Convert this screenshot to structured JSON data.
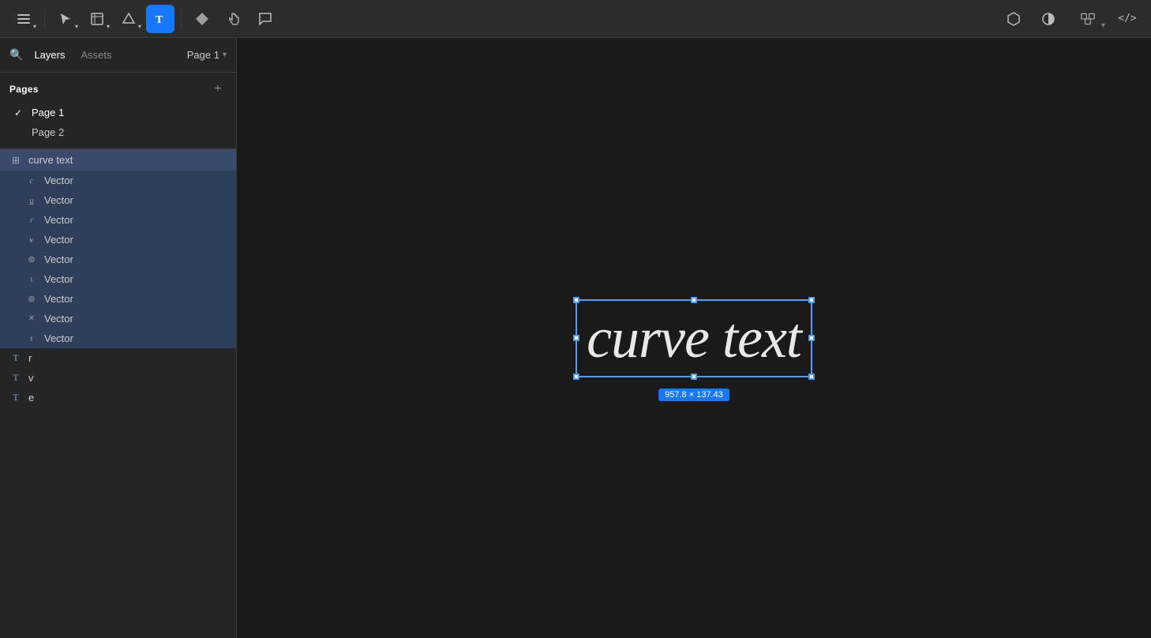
{
  "toolbar": {
    "tools": [
      {
        "id": "menu",
        "label": "☰",
        "icon": "menu-icon",
        "active": false,
        "hasChevron": true
      },
      {
        "id": "select",
        "label": "▲",
        "icon": "select-icon",
        "active": false,
        "hasChevron": true
      },
      {
        "id": "frame",
        "label": "⬜",
        "icon": "frame-icon",
        "active": false,
        "hasChevron": true
      },
      {
        "id": "shape",
        "label": "◯",
        "icon": "shape-icon",
        "active": false,
        "hasChevron": true
      },
      {
        "id": "text",
        "label": "T",
        "icon": "text-icon",
        "active": true,
        "hasChevron": false
      },
      {
        "id": "component",
        "label": "❖",
        "icon": "component-icon",
        "active": false,
        "hasChevron": false
      },
      {
        "id": "hand",
        "label": "✋",
        "icon": "hand-icon",
        "active": false,
        "hasChevron": false
      },
      {
        "id": "comment",
        "label": "💬",
        "icon": "comment-icon",
        "active": false,
        "hasChevron": false
      }
    ],
    "right_tools": [
      {
        "id": "plugins",
        "label": "⬡",
        "icon": "plugins-icon"
      },
      {
        "id": "contrast",
        "label": "◑",
        "icon": "contrast-icon"
      },
      {
        "id": "share",
        "label": "⬜⬜",
        "icon": "share-icon"
      },
      {
        "id": "code",
        "label": "</>",
        "icon": "code-icon"
      }
    ]
  },
  "sidebar": {
    "search_icon": "🔍",
    "tabs": [
      {
        "id": "layers",
        "label": "Layers",
        "active": true
      },
      {
        "id": "assets",
        "label": "Assets",
        "active": false
      }
    ],
    "page_selector": {
      "label": "Page 1",
      "chevron": "▾"
    },
    "pages_section": {
      "title": "Pages",
      "add_label": "+",
      "items": [
        {
          "id": "page1",
          "label": "Page 1",
          "active": true
        },
        {
          "id": "page2",
          "label": "Page 2",
          "active": false
        }
      ]
    },
    "layers": {
      "group": {
        "icon": "⊞",
        "label": "curve text"
      },
      "children": [
        {
          "icon": "ℂ",
          "label": "Vector"
        },
        {
          "icon": "𝕌",
          "label": "Vector"
        },
        {
          "icon": "𝕀",
          "label": "Vector"
        },
        {
          "icon": "𝕍",
          "label": "Vector"
        },
        {
          "icon": "⊛",
          "label": "Vector"
        },
        {
          "icon": "𝕥",
          "label": "Vector"
        },
        {
          "icon": "⊛",
          "label": "Vector"
        },
        {
          "icon": "✕",
          "label": "Vector"
        },
        {
          "icon": "𝕥",
          "label": "Vector"
        }
      ],
      "plain_items": [
        {
          "icon": "T",
          "label": "r"
        },
        {
          "icon": "T",
          "label": "v"
        },
        {
          "icon": "T",
          "label": "e"
        }
      ]
    }
  },
  "canvas": {
    "text": "curve text",
    "dimension_label": "957.8 × 137.43"
  }
}
